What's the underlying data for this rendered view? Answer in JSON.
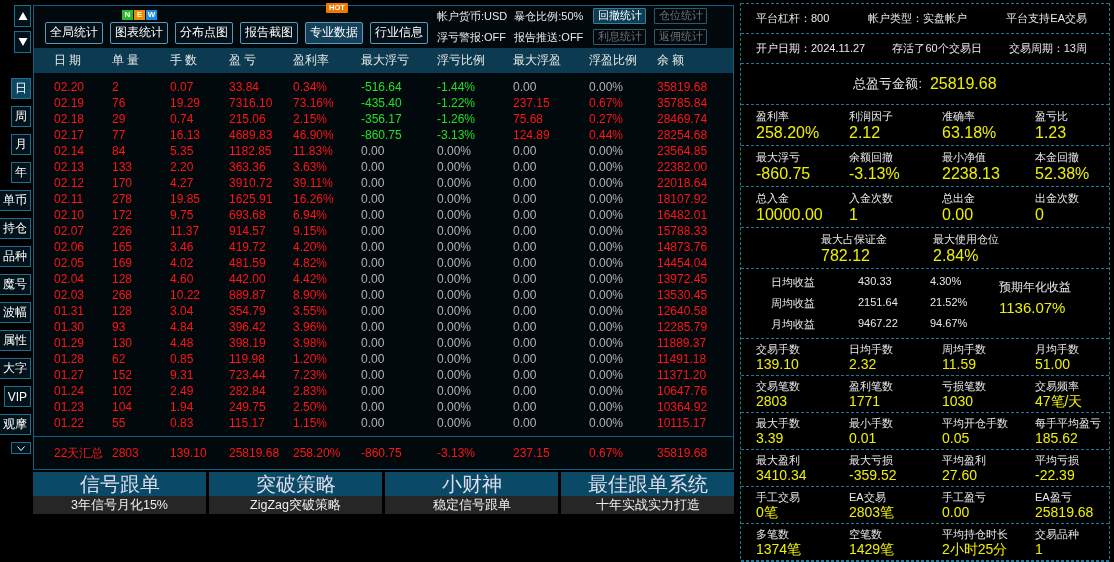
{
  "sidebar": {
    "tabs": [
      {
        "label": "日",
        "selected": true
      },
      {
        "label": "周",
        "selected": false
      },
      {
        "label": "月",
        "selected": false
      },
      {
        "label": "年",
        "selected": false
      },
      {
        "label": "单币",
        "selected": false
      },
      {
        "label": "持仓",
        "selected": false
      },
      {
        "label": "品种",
        "selected": false
      },
      {
        "label": "魔号",
        "selected": false
      },
      {
        "label": "波幅",
        "selected": false
      },
      {
        "label": "属性",
        "selected": false
      },
      {
        "label": "大字",
        "selected": false
      },
      {
        "label": "VIP",
        "selected": false
      },
      {
        "label": "观摩",
        "selected": false
      }
    ]
  },
  "toolbar": {
    "buttons": [
      {
        "label": "全局统计",
        "selected": false
      },
      {
        "label": "图表统计",
        "selected": false,
        "badge": {
          "kind": "new",
          "letters": [
            {
              "text": "N",
              "color": "#2db82d"
            },
            {
              "text": "E",
              "color": "#f08c00"
            },
            {
              "text": "W",
              "color": "#1e8ce6"
            }
          ]
        }
      },
      {
        "label": "分布点图",
        "selected": false
      },
      {
        "label": "报告截图",
        "selected": false
      },
      {
        "label": "专业数据",
        "selected": true,
        "badge": {
          "kind": "hot",
          "text": "HOT"
        }
      },
      {
        "label": "行业信息",
        "selected": false
      }
    ],
    "info": [
      [
        "帐户货币:USD",
        "暴仓比例:50%"
      ],
      [
        "浮亏警报:OFF",
        "报告推送:OFF"
      ]
    ],
    "small_buttons": [
      {
        "label": "回撤统计",
        "disabled": false
      },
      {
        "label": "仓位统计",
        "disabled": true
      },
      {
        "label": "利息统计",
        "disabled": true
      },
      {
        "label": "返佣统计",
        "disabled": true
      }
    ]
  },
  "table": {
    "columns": [
      "日 期",
      "单 量",
      "手 数",
      "盈 亏",
      "盈利率",
      "最大浮亏",
      "浮亏比例",
      "最大浮盈",
      "浮盈比例",
      "余 额"
    ],
    "rows": [
      {
        "cells": [
          "02.20",
          "2",
          "0.07",
          "33.84",
          "0.34%",
          "-516.64",
          "-1.44%",
          "0.00",
          "0.00%",
          "35819.68"
        ],
        "loss": true,
        "gain": false
      },
      {
        "cells": [
          "02.19",
          "76",
          "19.29",
          "7316.10",
          "73.16%",
          "-435.40",
          "-1.22%",
          "237.15",
          "0.67%",
          "35785.84"
        ],
        "loss": true,
        "gain": true
      },
      {
        "cells": [
          "02.18",
          "29",
          "0.74",
          "215.06",
          "2.15%",
          "-356.17",
          "-1.26%",
          "75.68",
          "0.27%",
          "28469.74"
        ],
        "loss": true,
        "gain": true
      },
      {
        "cells": [
          "02.17",
          "77",
          "16.13",
          "4689.83",
          "46.90%",
          "-860.75",
          "-3.13%",
          "124.89",
          "0.44%",
          "28254.68"
        ],
        "loss": true,
        "gain": true
      },
      {
        "cells": [
          "02.14",
          "84",
          "5.35",
          "1182.85",
          "11.83%",
          "0.00",
          "0.00%",
          "0.00",
          "0.00%",
          "23564.85"
        ],
        "loss": false,
        "gain": false
      },
      {
        "cells": [
          "02.13",
          "133",
          "2.20",
          "363.36",
          "3.63%",
          "0.00",
          "0.00%",
          "0.00",
          "0.00%",
          "22382.00"
        ],
        "loss": false,
        "gain": false
      },
      {
        "cells": [
          "02.12",
          "170",
          "4.27",
          "3910.72",
          "39.11%",
          "0.00",
          "0.00%",
          "0.00",
          "0.00%",
          "22018.64"
        ],
        "loss": false,
        "gain": false
      },
      {
        "cells": [
          "02.11",
          "278",
          "19.85",
          "1625.91",
          "16.26%",
          "0.00",
          "0.00%",
          "0.00",
          "0.00%",
          "18107.92"
        ],
        "loss": false,
        "gain": false
      },
      {
        "cells": [
          "02.10",
          "172",
          "9.75",
          "693.68",
          "6.94%",
          "0.00",
          "0.00%",
          "0.00",
          "0.00%",
          "16482.01"
        ],
        "loss": false,
        "gain": false
      },
      {
        "cells": [
          "02.07",
          "226",
          "11.37",
          "914.57",
          "9.15%",
          "0.00",
          "0.00%",
          "0.00",
          "0.00%",
          "15788.33"
        ],
        "loss": false,
        "gain": false
      },
      {
        "cells": [
          "02.06",
          "165",
          "3.46",
          "419.72",
          "4.20%",
          "0.00",
          "0.00%",
          "0.00",
          "0.00%",
          "14873.76"
        ],
        "loss": false,
        "gain": false
      },
      {
        "cells": [
          "02.05",
          "169",
          "4.02",
          "481.59",
          "4.82%",
          "0.00",
          "0.00%",
          "0.00",
          "0.00%",
          "14454.04"
        ],
        "loss": false,
        "gain": false
      },
      {
        "cells": [
          "02.04",
          "128",
          "4.60",
          "442.00",
          "4.42%",
          "0.00",
          "0.00%",
          "0.00",
          "0.00%",
          "13972.45"
        ],
        "loss": false,
        "gain": false
      },
      {
        "cells": [
          "02.03",
          "268",
          "10.22",
          "889.87",
          "8.90%",
          "0.00",
          "0.00%",
          "0.00",
          "0.00%",
          "13530.45"
        ],
        "loss": false,
        "gain": false
      },
      {
        "cells": [
          "01.31",
          "128",
          "3.04",
          "354.79",
          "3.55%",
          "0.00",
          "0.00%",
          "0.00",
          "0.00%",
          "12640.58"
        ],
        "loss": false,
        "gain": false
      },
      {
        "cells": [
          "01.30",
          "93",
          "4.84",
          "396.42",
          "3.96%",
          "0.00",
          "0.00%",
          "0.00",
          "0.00%",
          "12285.79"
        ],
        "loss": false,
        "gain": false
      },
      {
        "cells": [
          "01.29",
          "130",
          "4.48",
          "398.19",
          "3.98%",
          "0.00",
          "0.00%",
          "0.00",
          "0.00%",
          "11889.37"
        ],
        "loss": false,
        "gain": false
      },
      {
        "cells": [
          "01.28",
          "62",
          "0.85",
          "119.98",
          "1.20%",
          "0.00",
          "0.00%",
          "0.00",
          "0.00%",
          "11491.18"
        ],
        "loss": false,
        "gain": false
      },
      {
        "cells": [
          "01.27",
          "152",
          "9.31",
          "723.44",
          "7.23%",
          "0.00",
          "0.00%",
          "0.00",
          "0.00%",
          "11371.20"
        ],
        "loss": false,
        "gain": false
      },
      {
        "cells": [
          "01.24",
          "102",
          "2.49",
          "282.84",
          "2.83%",
          "0.00",
          "0.00%",
          "0.00",
          "0.00%",
          "10647.76"
        ],
        "loss": false,
        "gain": false
      },
      {
        "cells": [
          "01.23",
          "104",
          "1.94",
          "249.75",
          "2.50%",
          "0.00",
          "0.00%",
          "0.00",
          "0.00%",
          "10364.92"
        ],
        "loss": false,
        "gain": false
      },
      {
        "cells": [
          "01.22",
          "55",
          "0.83",
          "115.17",
          "1.15%",
          "0.00",
          "0.00%",
          "0.00",
          "0.00%",
          "10115.17"
        ],
        "loss": false,
        "gain": false
      }
    ],
    "summary": [
      "22天汇总",
      "2803",
      "139.10",
      "25819.68",
      "258.20%",
      "-860.75",
      "-3.13%",
      "237.15",
      "0.67%",
      "35819.68"
    ]
  },
  "banners": [
    {
      "title": "信号跟单",
      "subtitle": "3年信号月化15%"
    },
    {
      "title": "突破策略",
      "subtitle": "ZigZag突破策略"
    },
    {
      "title": "小财神",
      "subtitle": "稳定信号跟单"
    },
    {
      "title": "最佳跟单系统",
      "subtitle": "十年实战实力打造"
    }
  ],
  "account": [
    [
      "平台杠杆：800",
      "帐户类型：实盘帐户",
      "平台支持EA交易"
    ],
    [
      "开户日期：2024.11.27",
      "存活了60个交易日",
      "交易周期：13周"
    ]
  ],
  "total": {
    "label": "总盈亏金额:",
    "value": "25819.68"
  },
  "stat_groups": [
    {
      "kind": "full",
      "items": [
        {
          "label": "盈利率",
          "value": "258.20%"
        },
        {
          "label": "利润因子",
          "value": "2.12"
        },
        {
          "label": "准确率",
          "value": "63.18%"
        },
        {
          "label": "盈亏比",
          "value": "1.23"
        }
      ]
    },
    {
      "kind": "full",
      "items": [
        {
          "label": "最大浮亏",
          "value": "-860.75"
        },
        {
          "label": "余额回撤",
          "value": "-3.13%"
        },
        {
          "label": "最小净值",
          "value": "2238.13"
        },
        {
          "label": "本金回撤",
          "value": "52.38%"
        }
      ]
    },
    {
      "kind": "full",
      "items": [
        {
          "label": "总入金",
          "value": "10000.00"
        },
        {
          "label": "入金次数",
          "value": "1"
        },
        {
          "label": "总出金",
          "value": "0.00"
        },
        {
          "label": "出金次数",
          "value": "0"
        }
      ]
    },
    {
      "kind": "pair",
      "items": [
        {
          "label": "最大占保证金",
          "value": "782.12"
        },
        {
          "label": "最大使用仓位",
          "value": "2.84%"
        }
      ]
    }
  ],
  "averages": {
    "rows": [
      {
        "label": "日均收益",
        "amount": "430.33",
        "pct": "4.30%"
      },
      {
        "label": "周均收益",
        "amount": "2151.64",
        "pct": "21.52%"
      },
      {
        "label": "月均收益",
        "amount": "9467.22",
        "pct": "94.67%"
      }
    ],
    "projected": {
      "label": "预期年化收益",
      "value": "1136.07%"
    }
  },
  "detail_groups": [
    {
      "kind": "compact",
      "items": [
        {
          "label": "交易手数",
          "value": "139.10"
        },
        {
          "label": "日均手数",
          "value": "2.32"
        },
        {
          "label": "周均手数",
          "value": "11.59"
        },
        {
          "label": "月均手数",
          "value": "51.00"
        }
      ]
    },
    {
      "kind": "compact",
      "items": [
        {
          "label": "交易笔数",
          "value": "2803"
        },
        {
          "label": "盈利笔数",
          "value": "1771"
        },
        {
          "label": "亏损笔数",
          "value": "1030"
        },
        {
          "label": "交易频率",
          "value": "47笔/天"
        }
      ]
    },
    {
      "kind": "compact",
      "items": [
        {
          "label": "最大手数",
          "value": "3.39"
        },
        {
          "label": "最小手数",
          "value": "0.01"
        },
        {
          "label": "平均开仓手数",
          "value": "0.05"
        },
        {
          "label": "每手平均盈亏",
          "value": "185.62"
        }
      ]
    },
    {
      "kind": "compact",
      "items": [
        {
          "label": "最大盈利",
          "value": "3410.34"
        },
        {
          "label": "最大亏损",
          "value": "-359.52"
        },
        {
          "label": "平均盈利",
          "value": "27.60"
        },
        {
          "label": "平均亏损",
          "value": "-22.39"
        }
      ]
    },
    {
      "kind": "compact",
      "items": [
        {
          "label": "手工交易",
          "value": "0笔"
        },
        {
          "label": "EA交易",
          "value": "2803笔"
        },
        {
          "label": "手工盈亏",
          "value": "0.00"
        },
        {
          "label": "EA盈亏",
          "value": "25819.68"
        }
      ]
    },
    {
      "kind": "compact",
      "items": [
        {
          "label": "多笔数",
          "value": "1374笔"
        },
        {
          "label": "空笔数",
          "value": "1429笔"
        },
        {
          "label": "平均持仓时长",
          "value": "2小时25分"
        },
        {
          "label": "交易品种",
          "value": "1"
        }
      ]
    }
  ]
}
